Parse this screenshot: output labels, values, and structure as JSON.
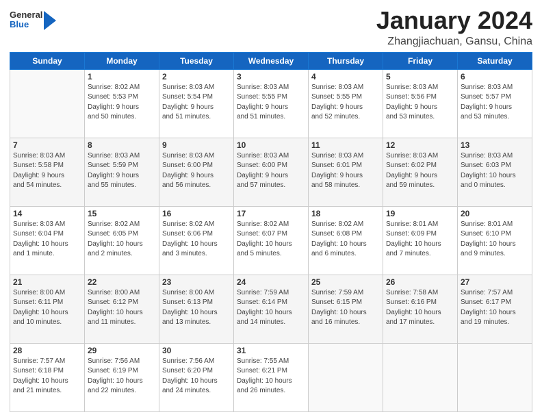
{
  "logo": {
    "general": "General",
    "blue": "Blue"
  },
  "header": {
    "month": "January 2024",
    "location": "Zhangjiachuan, Gansu, China"
  },
  "weekdays": [
    "Sunday",
    "Monday",
    "Tuesday",
    "Wednesday",
    "Thursday",
    "Friday",
    "Saturday"
  ],
  "weeks": [
    [
      {
        "day": "",
        "info": ""
      },
      {
        "day": "1",
        "info": "Sunrise: 8:02 AM\nSunset: 5:53 PM\nDaylight: 9 hours\nand 50 minutes."
      },
      {
        "day": "2",
        "info": "Sunrise: 8:03 AM\nSunset: 5:54 PM\nDaylight: 9 hours\nand 51 minutes."
      },
      {
        "day": "3",
        "info": "Sunrise: 8:03 AM\nSunset: 5:55 PM\nDaylight: 9 hours\nand 51 minutes."
      },
      {
        "day": "4",
        "info": "Sunrise: 8:03 AM\nSunset: 5:55 PM\nDaylight: 9 hours\nand 52 minutes."
      },
      {
        "day": "5",
        "info": "Sunrise: 8:03 AM\nSunset: 5:56 PM\nDaylight: 9 hours\nand 53 minutes."
      },
      {
        "day": "6",
        "info": "Sunrise: 8:03 AM\nSunset: 5:57 PM\nDaylight: 9 hours\nand 53 minutes."
      }
    ],
    [
      {
        "day": "7",
        "info": "Sunrise: 8:03 AM\nSunset: 5:58 PM\nDaylight: 9 hours\nand 54 minutes."
      },
      {
        "day": "8",
        "info": "Sunrise: 8:03 AM\nSunset: 5:59 PM\nDaylight: 9 hours\nand 55 minutes."
      },
      {
        "day": "9",
        "info": "Sunrise: 8:03 AM\nSunset: 6:00 PM\nDaylight: 9 hours\nand 56 minutes."
      },
      {
        "day": "10",
        "info": "Sunrise: 8:03 AM\nSunset: 6:00 PM\nDaylight: 9 hours\nand 57 minutes."
      },
      {
        "day": "11",
        "info": "Sunrise: 8:03 AM\nSunset: 6:01 PM\nDaylight: 9 hours\nand 58 minutes."
      },
      {
        "day": "12",
        "info": "Sunrise: 8:03 AM\nSunset: 6:02 PM\nDaylight: 9 hours\nand 59 minutes."
      },
      {
        "day": "13",
        "info": "Sunrise: 8:03 AM\nSunset: 6:03 PM\nDaylight: 10 hours\nand 0 minutes."
      }
    ],
    [
      {
        "day": "14",
        "info": "Sunrise: 8:03 AM\nSunset: 6:04 PM\nDaylight: 10 hours\nand 1 minute."
      },
      {
        "day": "15",
        "info": "Sunrise: 8:02 AM\nSunset: 6:05 PM\nDaylight: 10 hours\nand 2 minutes."
      },
      {
        "day": "16",
        "info": "Sunrise: 8:02 AM\nSunset: 6:06 PM\nDaylight: 10 hours\nand 3 minutes."
      },
      {
        "day": "17",
        "info": "Sunrise: 8:02 AM\nSunset: 6:07 PM\nDaylight: 10 hours\nand 5 minutes."
      },
      {
        "day": "18",
        "info": "Sunrise: 8:02 AM\nSunset: 6:08 PM\nDaylight: 10 hours\nand 6 minutes."
      },
      {
        "day": "19",
        "info": "Sunrise: 8:01 AM\nSunset: 6:09 PM\nDaylight: 10 hours\nand 7 minutes."
      },
      {
        "day": "20",
        "info": "Sunrise: 8:01 AM\nSunset: 6:10 PM\nDaylight: 10 hours\nand 9 minutes."
      }
    ],
    [
      {
        "day": "21",
        "info": "Sunrise: 8:00 AM\nSunset: 6:11 PM\nDaylight: 10 hours\nand 10 minutes."
      },
      {
        "day": "22",
        "info": "Sunrise: 8:00 AM\nSunset: 6:12 PM\nDaylight: 10 hours\nand 11 minutes."
      },
      {
        "day": "23",
        "info": "Sunrise: 8:00 AM\nSunset: 6:13 PM\nDaylight: 10 hours\nand 13 minutes."
      },
      {
        "day": "24",
        "info": "Sunrise: 7:59 AM\nSunset: 6:14 PM\nDaylight: 10 hours\nand 14 minutes."
      },
      {
        "day": "25",
        "info": "Sunrise: 7:59 AM\nSunset: 6:15 PM\nDaylight: 10 hours\nand 16 minutes."
      },
      {
        "day": "26",
        "info": "Sunrise: 7:58 AM\nSunset: 6:16 PM\nDaylight: 10 hours\nand 17 minutes."
      },
      {
        "day": "27",
        "info": "Sunrise: 7:57 AM\nSunset: 6:17 PM\nDaylight: 10 hours\nand 19 minutes."
      }
    ],
    [
      {
        "day": "28",
        "info": "Sunrise: 7:57 AM\nSunset: 6:18 PM\nDaylight: 10 hours\nand 21 minutes."
      },
      {
        "day": "29",
        "info": "Sunrise: 7:56 AM\nSunset: 6:19 PM\nDaylight: 10 hours\nand 22 minutes."
      },
      {
        "day": "30",
        "info": "Sunrise: 7:56 AM\nSunset: 6:20 PM\nDaylight: 10 hours\nand 24 minutes."
      },
      {
        "day": "31",
        "info": "Sunrise: 7:55 AM\nSunset: 6:21 PM\nDaylight: 10 hours\nand 26 minutes."
      },
      {
        "day": "",
        "info": ""
      },
      {
        "day": "",
        "info": ""
      },
      {
        "day": "",
        "info": ""
      }
    ]
  ]
}
